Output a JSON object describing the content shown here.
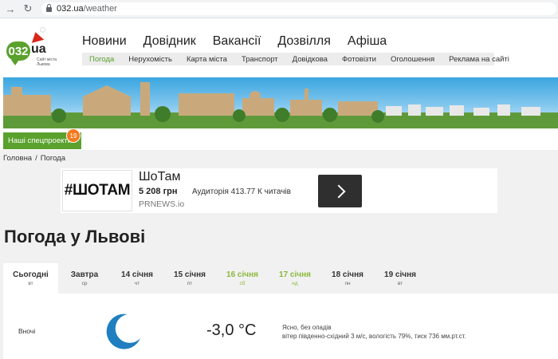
{
  "browser": {
    "url_host": "032.ua",
    "url_path": "/weather"
  },
  "logo": {
    "number": "032",
    "suffix": "ua",
    "tagline": "Сайт міста Львова"
  },
  "main_nav": [
    "Новини",
    "Довідник",
    "Вакансії",
    "Дозвілля",
    "Афіша"
  ],
  "sub_nav": {
    "items": [
      "Погода",
      "Нерухомість",
      "Карта міста",
      "Транспорт",
      "Довідкова",
      "Фотовізти",
      "Оголошення",
      "Реклама на сайті"
    ],
    "active_index": 0
  },
  "special": {
    "label": "Наші спецпроекти",
    "badge": "19"
  },
  "breadcrumb": {
    "home": "Головна",
    "separator": "/",
    "current": "Погода"
  },
  "ad": {
    "logo_text": "#ШОТАМ",
    "title": "ШоТам",
    "price": "5 208 грн",
    "audience": "Аудиторія 413.77 К читачів",
    "source": "PRNEWS.io"
  },
  "page_title": "Погода у Львові",
  "days": [
    {
      "label": "Сьогодні",
      "weekday": "вт",
      "weekend": false
    },
    {
      "label": "Завтра",
      "weekday": "ср",
      "weekend": false
    },
    {
      "label": "14 січня",
      "weekday": "чт",
      "weekend": false
    },
    {
      "label": "15 січня",
      "weekday": "пт",
      "weekend": false
    },
    {
      "label": "16 січня",
      "weekday": "сб",
      "weekend": true
    },
    {
      "label": "17 січня",
      "weekday": "нд",
      "weekend": true
    },
    {
      "label": "18 січня",
      "weekday": "пн",
      "weekend": false
    },
    {
      "label": "19 січня",
      "weekday": "вт",
      "weekend": false
    }
  ],
  "forecast": {
    "period": "Вночі",
    "icon": "moon-icon",
    "temperature": "-3,0 °C",
    "summary": "Ясно, без опадів",
    "details": "вітер південно-східний 3 м/с, вологість 79%, тиск 736 мм.рт.ст."
  },
  "colors": {
    "accent": "#5aa12d",
    "badge": "#f47a1f",
    "weekend": "#8ab83c",
    "moon": "#1f7fc0"
  }
}
